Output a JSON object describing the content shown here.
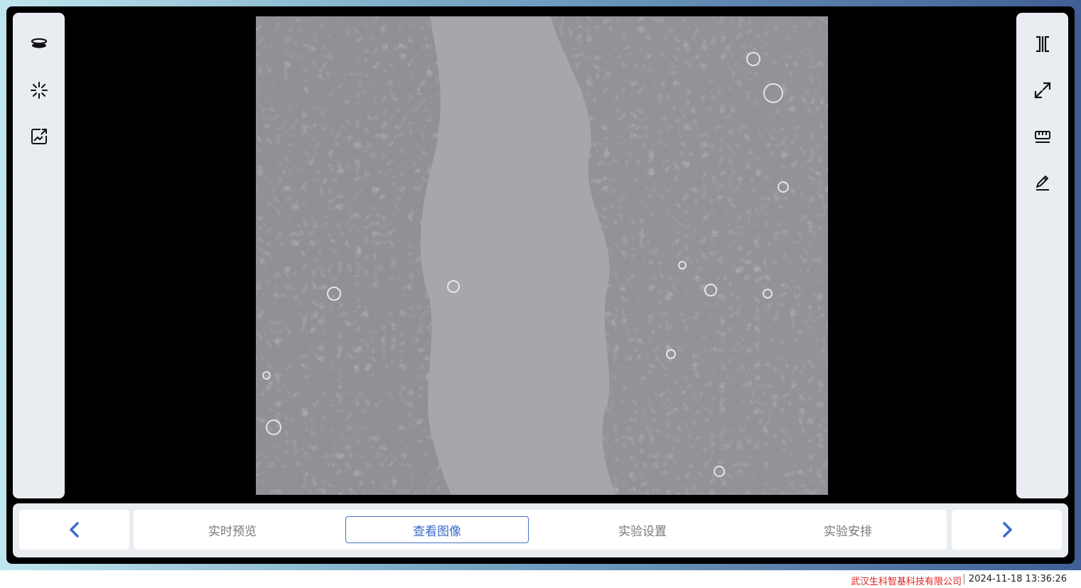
{
  "left_toolbar": {
    "tools": [
      {
        "icon": "focus-layers-icon"
      },
      {
        "icon": "sparkle-enhance-icon"
      },
      {
        "icon": "image-transfer-icon"
      }
    ]
  },
  "right_toolbar": {
    "tools": [
      {
        "icon": "split-compare-icon"
      },
      {
        "icon": "expand-fullscreen-icon"
      },
      {
        "icon": "ruler-measure-icon"
      },
      {
        "icon": "pencil-edit-icon"
      }
    ]
  },
  "viewer": {
    "description_icon": "microscope-image"
  },
  "bottom_nav": {
    "prev_icon": "chevron-left-icon",
    "next_icon": "chevron-right-icon",
    "tabs": [
      {
        "label": "实时预览"
      },
      {
        "label": "查看图像"
      },
      {
        "label": "实验设置"
      },
      {
        "label": "实验安排"
      }
    ],
    "active_index": 1
  },
  "status_bar": {
    "company": "武汉生科智基科技有限公司",
    "datetime": "2024-11-18 13:36:26"
  },
  "colors": {
    "accent": "#3a6bc8",
    "panel_bg": "#e9edf2",
    "company_red": "#e02020"
  }
}
